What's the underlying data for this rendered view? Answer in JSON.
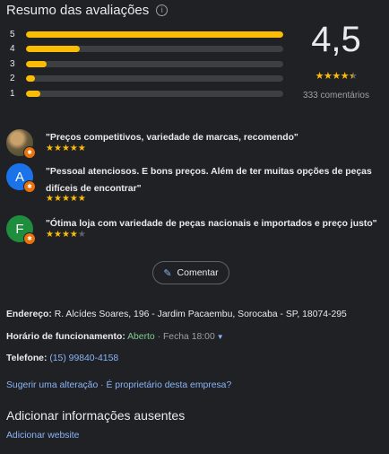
{
  "header": {
    "title": "Resumo das avaliações",
    "info_icon": "i"
  },
  "rating_bars": [
    {
      "label": "5",
      "fraction": 1.0
    },
    {
      "label": "4",
      "fraction": 0.21
    },
    {
      "label": "3",
      "fraction": 0.08
    },
    {
      "label": "2",
      "fraction": 0.035
    },
    {
      "label": "1",
      "fraction": 0.055
    }
  ],
  "summary": {
    "rating": "4,5",
    "stars": 4.5,
    "count_text": "333 comentários"
  },
  "reviews": [
    {
      "text": "\"Preços competitivos, variedade de marcas, recomendo\"",
      "stars": 5,
      "avatar_letter": "",
      "avatar_color": "#6b5b3e"
    },
    {
      "text": "\"Pessoal atenciosos. E bons preços. Além de ter muitas opções de peças difíceis de encontrar\"",
      "stars": 5,
      "avatar_letter": "A",
      "avatar_color": "#1a73e8"
    },
    {
      "text": "\"Ótima loja com variedade de peças nacionais e importados e preço justo\"",
      "stars": 4,
      "avatar_letter": "F",
      "avatar_color": "#1e8e3e"
    }
  ],
  "comment_button": {
    "label": "Comentar"
  },
  "address": {
    "label": "Endereço:",
    "value": " R. Alcídes Soares, 196 - Jardim Pacaembu, Sorocaba - SP, 18074-295"
  },
  "hours": {
    "label": "Horário de funcionamento:",
    "status": " Aberto",
    "detail": " · Fecha 18:00"
  },
  "phone": {
    "label": "Telefone:",
    "value": "(15) 99840-4158"
  },
  "suggest": {
    "edit_link": "Sugerir uma alteração",
    "separator": " · ",
    "owner_link": "É proprietário desta empresa?"
  },
  "missing": {
    "title": "Adicionar informações ausentes",
    "website_link": "Adicionar website"
  },
  "colors": {
    "star": "#fbbc04",
    "track": "#3c4043",
    "link": "#8ab4f8",
    "open": "#81c995",
    "background": "#202124"
  }
}
